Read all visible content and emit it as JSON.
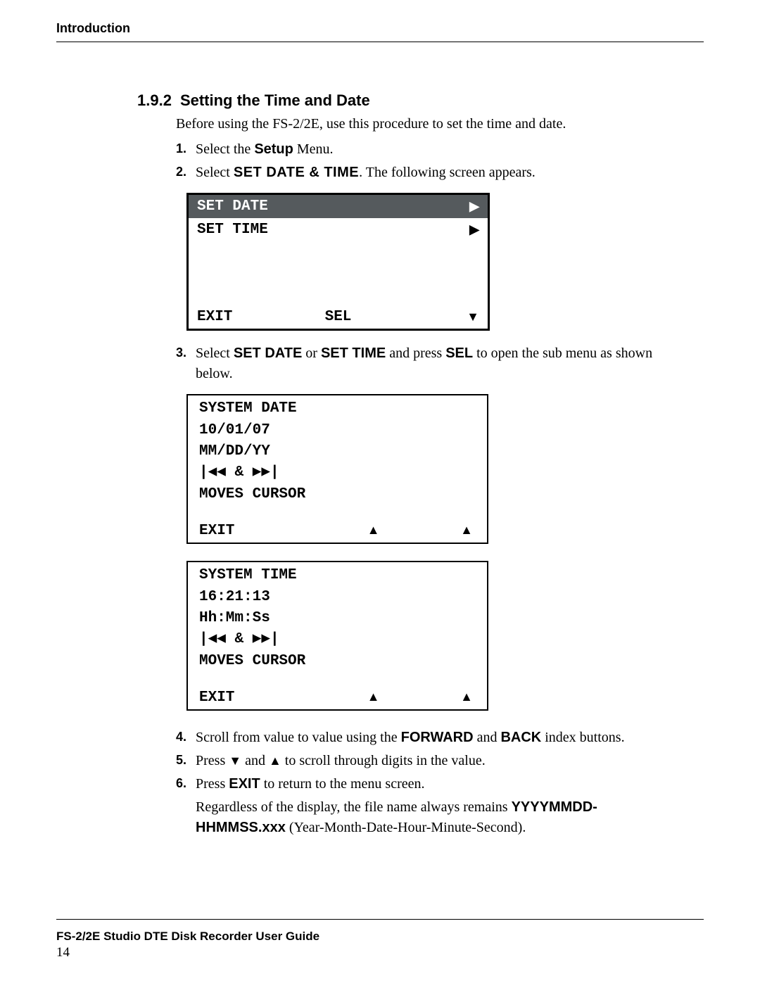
{
  "header": {
    "running_head": "Introduction"
  },
  "section": {
    "number": "1.9.2",
    "title": "Setting the Time and Date",
    "intro": "Before using the FS-2/2E, use this procedure to set the time and date."
  },
  "steps": {
    "s1": {
      "num": "1.",
      "pre": "Select the ",
      "bold": "Setup",
      "post": " Menu."
    },
    "s2": {
      "num": "2.",
      "pre": "Select ",
      "sc": "SET DATE & TIME",
      "post": ". The following screen appears."
    },
    "s3": {
      "num": "3.",
      "pre": "Select ",
      "sc1": "SET DATE",
      "mid1": " or ",
      "sc2": "SET TIME",
      "mid2": " and press ",
      "sc3": "SEL",
      "post": " to open the sub menu as shown below."
    },
    "s4": {
      "num": "4.",
      "pre": "Scroll from value to value using the ",
      "b1": "FORWARD",
      "mid": " and ",
      "b2": "BACK",
      "post": " index buttons."
    },
    "s5": {
      "num": "5.",
      "pre": "Press ",
      "d": "▼",
      "mid": " and ",
      "u": "▲",
      "post": " to scroll through digits in the value."
    },
    "s6": {
      "num": "6.",
      "pre": "Press ",
      "b": "EXIT",
      "post": " to return to the menu screen."
    }
  },
  "note": {
    "pre": "Regardless of the display, the file name always remains ",
    "b": "YYYYMMDD-HHMMSS.xxx",
    "post": " (Year-Month-Date-Hour-Minute-Second)."
  },
  "lcd1": {
    "row1": {
      "label": "SET DATE",
      "arrow": "▶"
    },
    "row2": {
      "label": "SET TIME",
      "arrow": "▶"
    },
    "bottom": {
      "left": "EXIT",
      "mid": "SEL",
      "right": "▼"
    }
  },
  "lcd_date": {
    "title": "SYSTEM DATE",
    "value": "10/01/07",
    "format": "MM/DD/YY",
    "nav": "|◀◀  &  ▶▶|",
    "hint": "MOVES CURSOR",
    "exit": "EXIT",
    "up1": "▲",
    "up2": "▲"
  },
  "lcd_time": {
    "title": "SYSTEM TIME",
    "value": "16:21:13",
    "format": "Hh:Mm:Ss",
    "nav": "|◀◀  &  ▶▶|",
    "hint": "MOVES CURSOR",
    "exit": "EXIT",
    "up1": "▲",
    "up2": "▲"
  },
  "footer": {
    "title": "FS-2/2E Studio DTE Disk Recorder User Guide",
    "page": "14"
  }
}
